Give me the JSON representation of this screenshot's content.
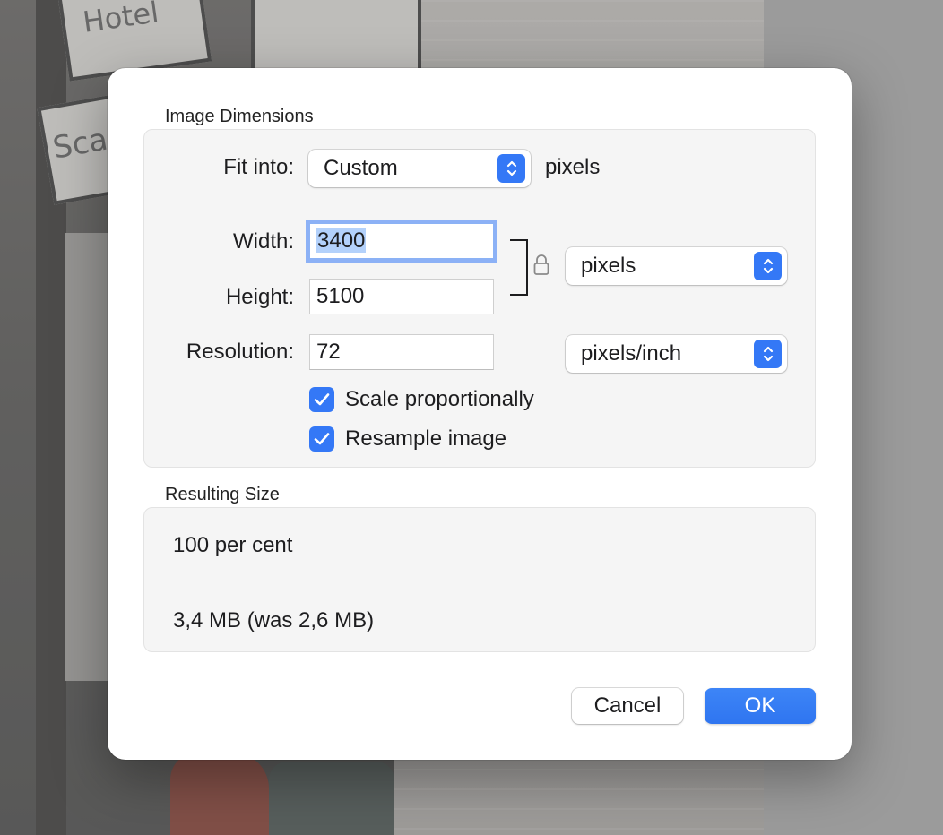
{
  "background": {
    "sign_hotel_text": "Hotel",
    "sign_scally_text": "Scally"
  },
  "dialog": {
    "image_dimensions": {
      "title": "Image Dimensions",
      "fit_into_label": "Fit into:",
      "fit_into_value": "Custom",
      "fit_into_unit": "pixels",
      "width_label": "Width:",
      "width_value": "3400",
      "height_label": "Height:",
      "height_value": "5100",
      "size_unit": "pixels",
      "resolution_label": "Resolution:",
      "resolution_value": "72",
      "resolution_unit": "pixels/inch",
      "scale_proportionally_label": "Scale proportionally",
      "scale_proportionally_checked": true,
      "resample_label": "Resample image",
      "resample_checked": true
    },
    "resulting_size": {
      "title": "Resulting Size",
      "percent_text": "100 per cent",
      "size_text": "3,4 MB (was 2,6 MB)"
    },
    "buttons": {
      "cancel": "Cancel",
      "ok": "OK"
    }
  },
  "colors": {
    "accent": "#3478f6",
    "panel": "#f5f5f5"
  }
}
